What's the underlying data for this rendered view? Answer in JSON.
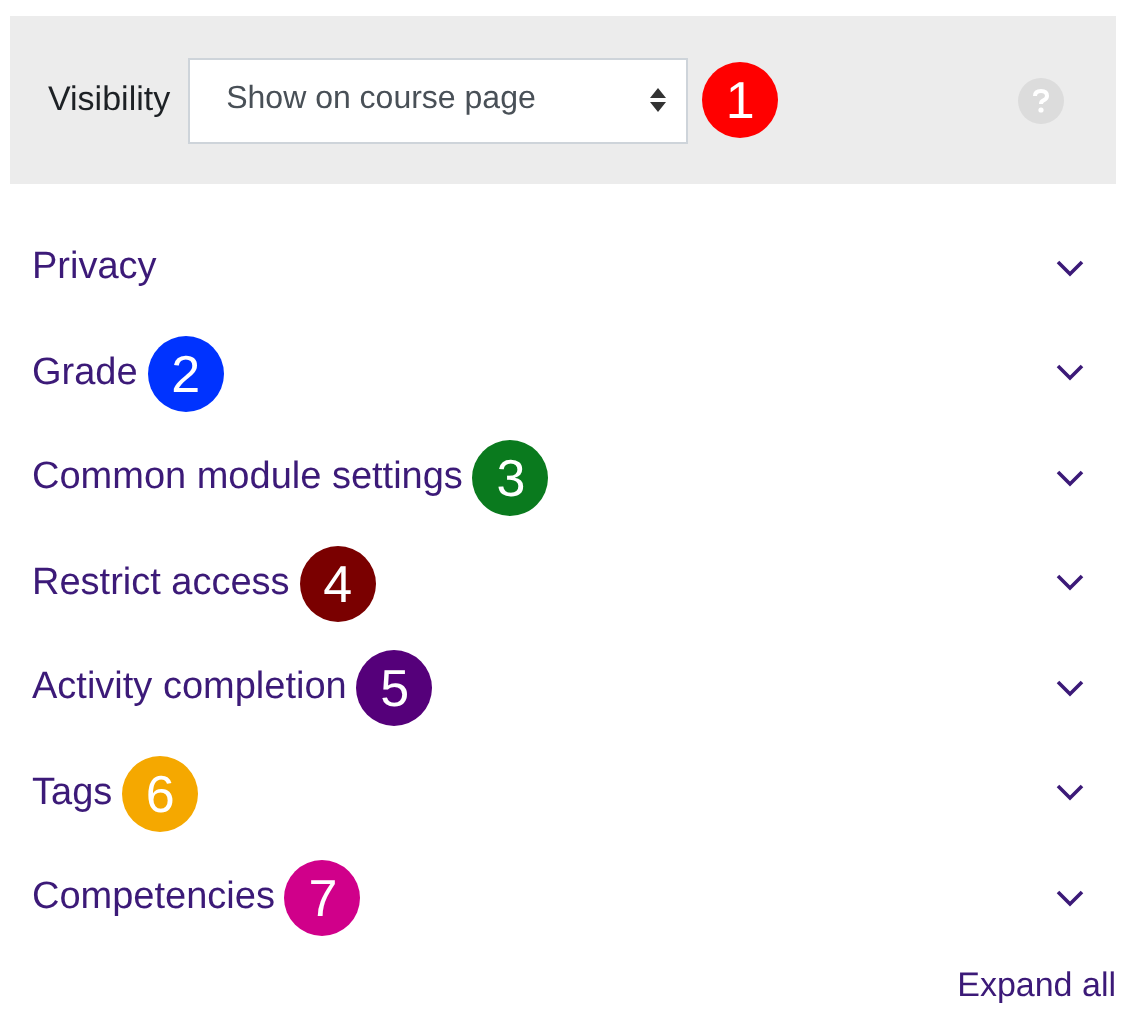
{
  "visibility": {
    "label": "Visibility",
    "value": "Show on course page",
    "badge": {
      "text": "1",
      "color": "#ff0000"
    }
  },
  "sections": [
    {
      "title": "Privacy",
      "expanded": false
    },
    {
      "title": "Grade",
      "expanded": false,
      "badge": {
        "text": "2",
        "color": "#0033ff"
      }
    },
    {
      "title": "Common module settings",
      "expanded": false,
      "badge": {
        "text": "3",
        "color": "#0a7a1e"
      }
    },
    {
      "title": "Restrict access",
      "expanded": false,
      "badge": {
        "text": "4",
        "color": "#7a0000"
      }
    },
    {
      "title": "Activity completion",
      "expanded": false,
      "badge": {
        "text": "5",
        "color": "#55007a"
      }
    },
    {
      "title": "Tags",
      "expanded": false,
      "badge": {
        "text": "6",
        "color": "#f5a800"
      }
    },
    {
      "title": "Competencies",
      "expanded": false,
      "badge": {
        "text": "7",
        "color": "#d0008a"
      }
    }
  ],
  "expand_all": "Expand all"
}
